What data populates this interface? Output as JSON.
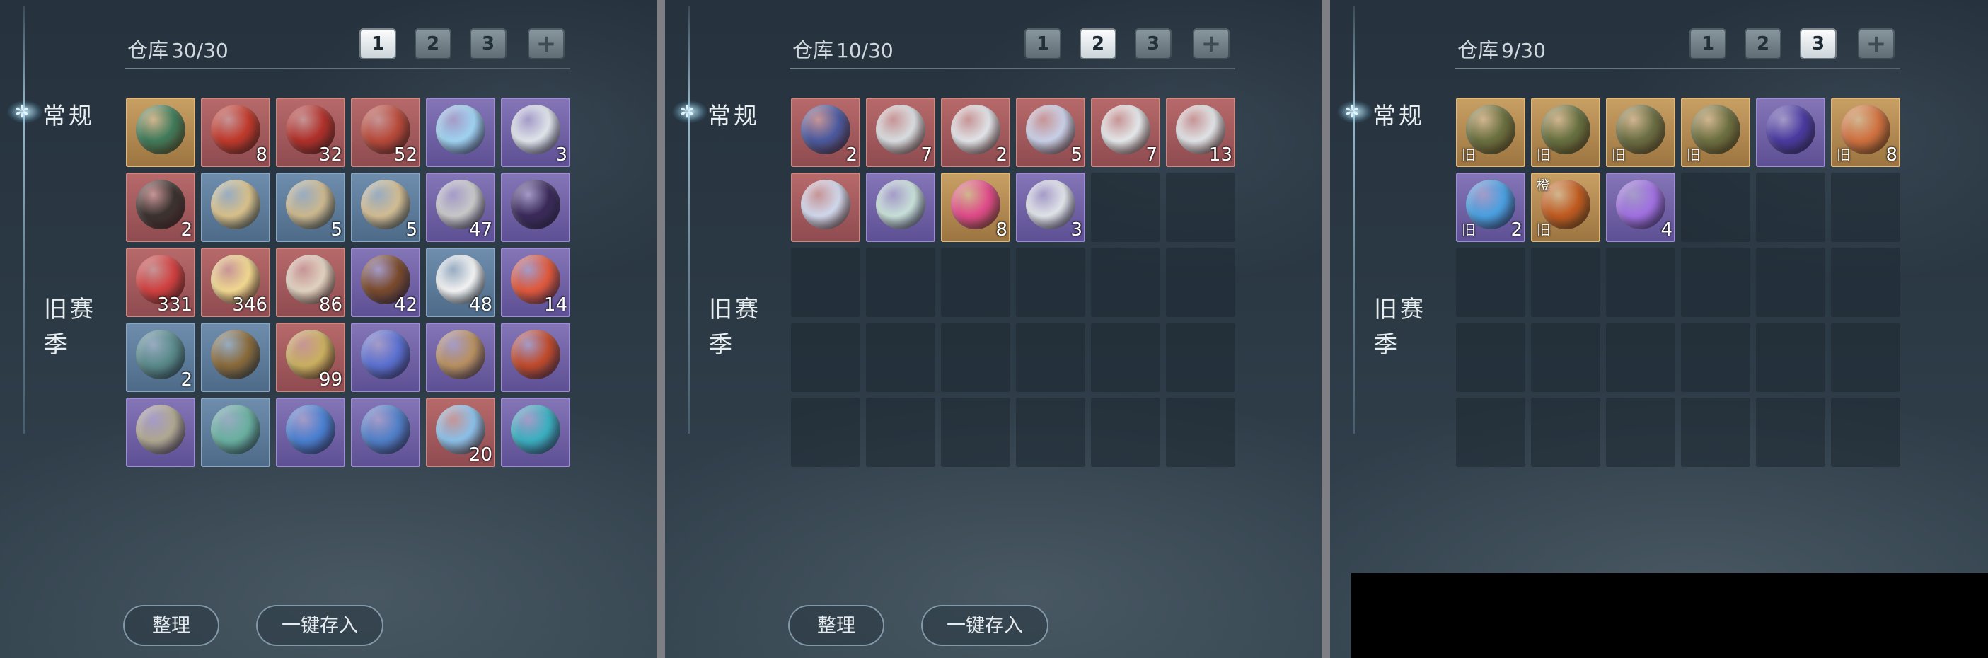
{
  "labels": {
    "storage": "仓库",
    "tab_regular": "常规",
    "tab_old_season": "旧赛季",
    "sort": "整理",
    "deposit_all": "一键存入",
    "add_page": "+"
  },
  "colors": {
    "red": "#9a5558",
    "blue": "#57769a",
    "purple": "#6a5ca3",
    "gold": "#a98150"
  },
  "panels": [
    {
      "count": "30/30",
      "active_page": 1,
      "pages": [
        "1",
        "2",
        "3"
      ],
      "items": [
        {
          "rarity": "gold",
          "icon": "jade-ring-icon",
          "color": "#3f7b5b",
          "qty": ""
        },
        {
          "rarity": "red",
          "icon": "gift-box-icon",
          "color": "#c0392b",
          "qty": "8"
        },
        {
          "rarity": "red",
          "icon": "firecracker-icon",
          "color": "#b0302a",
          "qty": "32"
        },
        {
          "rarity": "red",
          "icon": "scroll-roll-icon",
          "color": "#b84a3a",
          "qty": "52"
        },
        {
          "rarity": "purple",
          "icon": "butterfly-icon",
          "color": "#9fd3f0",
          "qty": ""
        },
        {
          "rarity": "purple",
          "icon": "porcelain-vase-icon",
          "color": "#dfe5ea",
          "qty": "3"
        },
        {
          "rarity": "red",
          "icon": "pouch-icon",
          "color": "#3a3330",
          "qty": "2"
        },
        {
          "rarity": "blue",
          "icon": "map-scroll-icon",
          "color": "#d8c08a",
          "qty": ""
        },
        {
          "rarity": "blue",
          "icon": "map-scroll-icon",
          "color": "#ccb88e",
          "qty": "5"
        },
        {
          "rarity": "blue",
          "icon": "map-scroll-icon",
          "color": "#d2bc92",
          "qty": "5"
        },
        {
          "rarity": "purple",
          "icon": "book-icon",
          "color": "#c8c8c8",
          "qty": "47"
        },
        {
          "rarity": "purple",
          "icon": "ornate-box-icon",
          "color": "#3a2a5a",
          "qty": ""
        },
        {
          "rarity": "red",
          "icon": "red-knot-icon",
          "color": "#d04040",
          "qty": "331"
        },
        {
          "rarity": "red",
          "icon": "paper-crane-icon",
          "color": "#f0d890",
          "qty": "346"
        },
        {
          "rarity": "red",
          "icon": "kite-icon",
          "color": "#e0d2c0",
          "qty": "86"
        },
        {
          "rarity": "purple",
          "icon": "treasure-chest-icon",
          "color": "#7a4a2a",
          "qty": "42"
        },
        {
          "rarity": "blue",
          "icon": "ghost-face-icon",
          "color": "#f2f2f2",
          "qty": "48"
        },
        {
          "rarity": "purple",
          "icon": "lotus-lantern-icon",
          "color": "#e0583a",
          "qty": "14"
        },
        {
          "rarity": "blue",
          "icon": "ore-stone-icon",
          "color": "#5a8a8a",
          "qty": "2"
        },
        {
          "rarity": "blue",
          "icon": "dagger-icon",
          "color": "#8a6a3a",
          "qty": ""
        },
        {
          "rarity": "red",
          "icon": "bamboo-scroll-icon",
          "color": "#c9b060",
          "qty": "99"
        },
        {
          "rarity": "purple",
          "icon": "blue-flower-icon",
          "color": "#5a70d0",
          "qty": ""
        },
        {
          "rarity": "purple",
          "icon": "arrows-icon",
          "color": "#b89060",
          "qty": ""
        },
        {
          "rarity": "purple",
          "icon": "red-book-icon",
          "color": "#c04a2a",
          "qty": ""
        },
        {
          "rarity": "purple",
          "icon": "silver-ore-icon",
          "color": "#b0a890",
          "qty": ""
        },
        {
          "rarity": "blue",
          "icon": "jade-ingot-icon",
          "color": "#6ab0a0",
          "qty": ""
        },
        {
          "rarity": "purple",
          "icon": "blue-scroll-icon",
          "color": "#4a80d0",
          "qty": ""
        },
        {
          "rarity": "purple",
          "icon": "blue-scroll-icon",
          "color": "#5080c8",
          "qty": ""
        },
        {
          "rarity": "red",
          "icon": "blue-cloth-icon",
          "color": "#8ac0e8",
          "qty": "20"
        },
        {
          "rarity": "purple",
          "icon": "teal-gem-icon",
          "color": "#3ab0c0",
          "qty": ""
        }
      ]
    },
    {
      "count": "10/30",
      "active_page": 2,
      "pages": [
        "1",
        "2",
        "3"
      ],
      "items": [
        {
          "rarity": "red",
          "icon": "potion-pouch-icon",
          "color": "#4a5aa0",
          "qty": "2"
        },
        {
          "rarity": "red",
          "icon": "white-bottle-icon",
          "color": "#d8dde0",
          "qty": "7"
        },
        {
          "rarity": "red",
          "icon": "white-bottle-icon",
          "color": "#e0e4e8",
          "qty": "2"
        },
        {
          "rarity": "red",
          "icon": "gourd-bottle-icon",
          "color": "#c8d0e8",
          "qty": "5"
        },
        {
          "rarity": "red",
          "icon": "red-cap-bottle-icon",
          "color": "#e4e8ea",
          "qty": "7"
        },
        {
          "rarity": "red",
          "icon": "tilted-bottle-icon",
          "color": "#dfe3e6",
          "qty": "13"
        },
        {
          "rarity": "red",
          "icon": "gourd-bottle-icon",
          "color": "#d0d8ec",
          "qty": ""
        },
        {
          "rarity": "purple",
          "icon": "jeweled-bottle-icon",
          "color": "#c8e0d8",
          "qty": ""
        },
        {
          "rarity": "gold",
          "icon": "pink-pearl-icon",
          "color": "#e04a8a",
          "qty": "8"
        },
        {
          "rarity": "purple",
          "icon": "red-cap-gourd-icon",
          "color": "#e0e4e8",
          "qty": "3"
        }
      ]
    },
    {
      "count": "9/30",
      "active_page": 3,
      "pages": [
        "1",
        "2",
        "3"
      ],
      "items": [
        {
          "rarity": "gold",
          "icon": "rock-ore-icon",
          "color": "#6a7040",
          "qty": "",
          "tag": "旧"
        },
        {
          "rarity": "gold",
          "icon": "rock-ore-icon",
          "color": "#667040",
          "qty": "",
          "tag": "旧"
        },
        {
          "rarity": "gold",
          "icon": "rock-ore-icon",
          "color": "#6a6e44",
          "qty": "",
          "tag": "旧"
        },
        {
          "rarity": "gold",
          "icon": "rock-ore-icon",
          "color": "#6c7042",
          "qty": "",
          "tag": "旧"
        },
        {
          "rarity": "purple",
          "icon": "purple-ore-icon",
          "color": "#4a3aa0",
          "qty": ""
        },
        {
          "rarity": "gold",
          "icon": "orange-ore-icon",
          "color": "#d07040",
          "qty": "8",
          "tag": "旧"
        },
        {
          "rarity": "purple",
          "icon": "blue-orb-icon",
          "color": "#4aa0e0",
          "qty": "2",
          "tag": "旧"
        },
        {
          "rarity": "gold",
          "icon": "amber-ore-icon",
          "color": "#c05a20",
          "qty": "",
          "tag": "旧",
          "tag_top": "橙"
        },
        {
          "rarity": "purple",
          "icon": "purple-ribbon-icon",
          "color": "#a070e0",
          "qty": "4"
        }
      ]
    }
  ]
}
